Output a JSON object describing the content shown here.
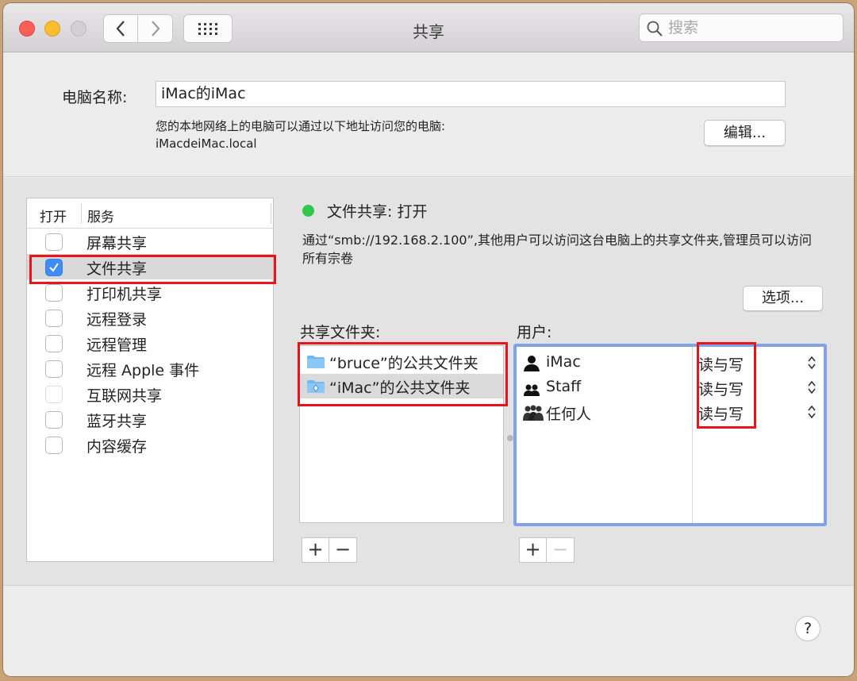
{
  "window": {
    "title": "共享",
    "search_placeholder": "搜索"
  },
  "computer": {
    "label": "电脑名称:",
    "name": "iMac的iMac",
    "address_note": "您的本地网络上的电脑可以通过以下地址访问您的电脑:",
    "address": "iMacdeiMac.local",
    "edit_button": "编辑..."
  },
  "services": {
    "header_on": "打开",
    "header_service": "服务",
    "items": [
      {
        "label": "屏幕共享",
        "checked": false,
        "selected": false,
        "enabled": true
      },
      {
        "label": "文件共享",
        "checked": true,
        "selected": true,
        "enabled": true
      },
      {
        "label": "打印机共享",
        "checked": false,
        "selected": false,
        "enabled": true
      },
      {
        "label": "远程登录",
        "checked": false,
        "selected": false,
        "enabled": true
      },
      {
        "label": "远程管理",
        "checked": false,
        "selected": false,
        "enabled": true
      },
      {
        "label": "远程 Apple 事件",
        "checked": false,
        "selected": false,
        "enabled": true
      },
      {
        "label": "互联网共享",
        "checked": false,
        "selected": false,
        "enabled": false
      },
      {
        "label": "蓝牙共享",
        "checked": false,
        "selected": false,
        "enabled": true
      },
      {
        "label": "内容缓存",
        "checked": false,
        "selected": false,
        "enabled": true
      }
    ]
  },
  "detail": {
    "status": "文件共享: 打开",
    "status_color": "#2fc84a",
    "description": "通过“smb://192.168.2.100”,其他用户可以访问这台电脑上的共享文件夹,管理员可以访问所有宗卷",
    "options_button": "选项...",
    "folders_label": "共享文件夹:",
    "users_label": "用户:",
    "folders": [
      {
        "label": "“bruce”的公共文件夹",
        "icon": "folder-icon",
        "selected": false
      },
      {
        "label": "“iMac”的公共文件夹",
        "icon": "public-folder-icon",
        "selected": true
      }
    ],
    "users": [
      {
        "name": "iMac",
        "icon": "single-user-icon",
        "permission": "读与写"
      },
      {
        "name": "Staff",
        "icon": "group-icon",
        "permission": "读与写"
      },
      {
        "name": "任何人",
        "icon": "everyone-icon",
        "permission": "读与写"
      }
    ],
    "add_symbol": "+",
    "remove_symbol": "−"
  },
  "help_symbol": "?",
  "colors": {
    "highlight": "#e8141c",
    "accent": "#3f8cf7",
    "focus_ring": "#7fa3e6"
  }
}
